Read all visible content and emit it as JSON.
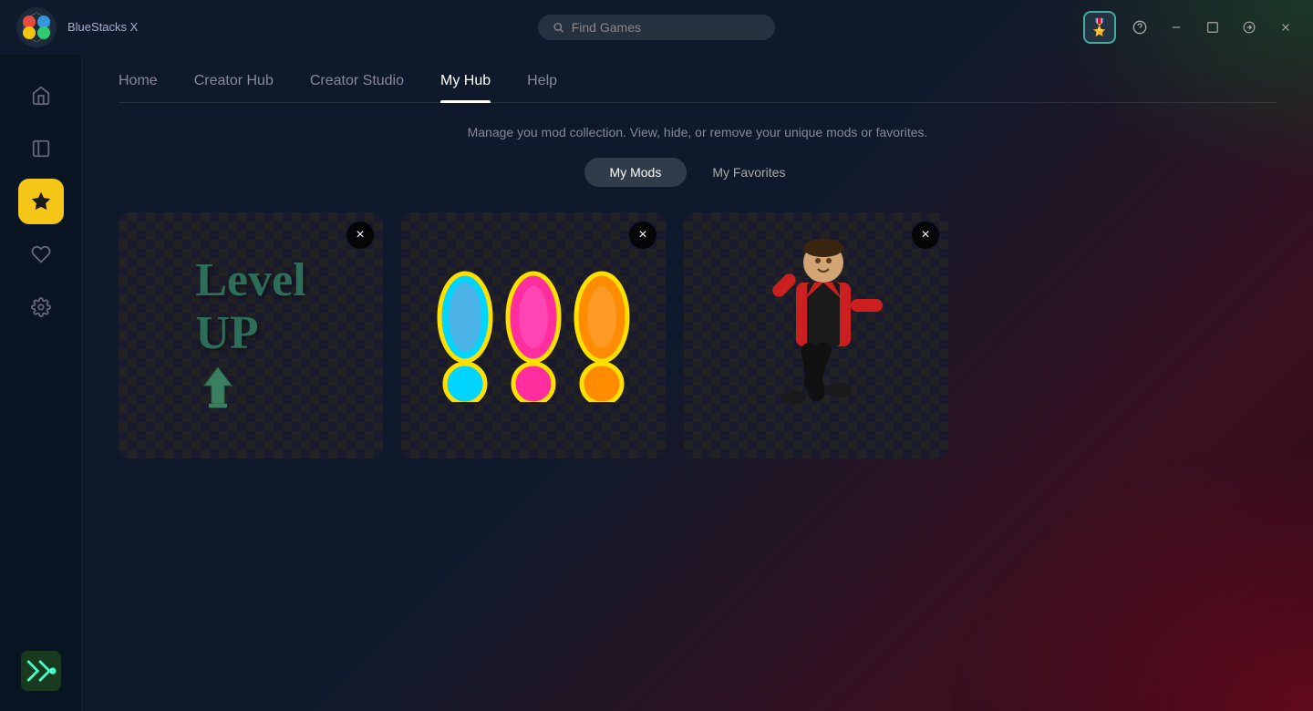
{
  "app": {
    "name": "BlueStacks X",
    "logo_text": "BlueStacks X"
  },
  "search": {
    "placeholder": "Find Games"
  },
  "titlebar": {
    "minimize_label": "minimize",
    "maximize_label": "maximize",
    "forward_label": "forward",
    "close_label": "close",
    "help_label": "help"
  },
  "nav": {
    "tabs": [
      {
        "id": "home",
        "label": "Home"
      },
      {
        "id": "creator-hub",
        "label": "Creator Hub"
      },
      {
        "id": "creator-studio",
        "label": "Creator Studio"
      },
      {
        "id": "my-hub",
        "label": "My Hub",
        "active": true
      },
      {
        "id": "help",
        "label": "Help"
      }
    ]
  },
  "sidebar": {
    "items": [
      {
        "id": "home",
        "icon": "⌂",
        "label": "home"
      },
      {
        "id": "library",
        "icon": "⊟",
        "label": "library"
      },
      {
        "id": "mods",
        "icon": "★",
        "label": "mods",
        "active": true
      },
      {
        "id": "favorites",
        "icon": "♡",
        "label": "favorites"
      },
      {
        "id": "settings",
        "icon": "⚙",
        "label": "settings"
      }
    ]
  },
  "page": {
    "description": "Manage you mod collection. View, hide, or remove your unique mods or favorites.",
    "sub_tabs": [
      {
        "id": "my-mods",
        "label": "My Mods",
        "active": true
      },
      {
        "id": "my-favorites",
        "label": "My Favorites"
      }
    ]
  },
  "mods": [
    {
      "id": "mod1",
      "type": "level-up",
      "close_label": "×"
    },
    {
      "id": "mod2",
      "type": "colorful",
      "close_label": "×"
    },
    {
      "id": "mod3",
      "type": "person",
      "close_label": "×"
    }
  ],
  "colors": {
    "accent": "#f5c518",
    "active_tab": "#ffffff",
    "bg_dark": "#0e1a2b"
  }
}
